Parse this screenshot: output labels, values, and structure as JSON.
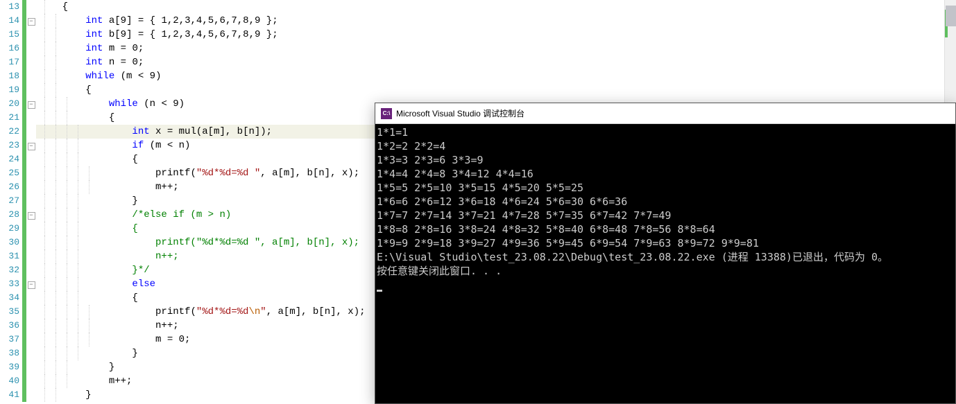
{
  "editor": {
    "startLine": 13,
    "highlightedLine": 22,
    "foldLines": [
      14,
      20,
      23,
      28,
      33
    ],
    "lines": [
      {
        "n": 13,
        "tokens": [
          {
            "t": "{",
            "c": "txt"
          }
        ],
        "indent": 2
      },
      {
        "n": 14,
        "tokens": [
          {
            "t": "int",
            "c": "ty"
          },
          {
            "t": " a[",
            "c": "txt"
          },
          {
            "t": "9",
            "c": "num"
          },
          {
            "t": "] = { ",
            "c": "txt"
          },
          {
            "t": "1",
            "c": "num"
          },
          {
            "t": ",",
            "c": "txt"
          },
          {
            "t": "2",
            "c": "num"
          },
          {
            "t": ",",
            "c": "txt"
          },
          {
            "t": "3",
            "c": "num"
          },
          {
            "t": ",",
            "c": "txt"
          },
          {
            "t": "4",
            "c": "num"
          },
          {
            "t": ",",
            "c": "txt"
          },
          {
            "t": "5",
            "c": "num"
          },
          {
            "t": ",",
            "c": "txt"
          },
          {
            "t": "6",
            "c": "num"
          },
          {
            "t": ",",
            "c": "txt"
          },
          {
            "t": "7",
            "c": "num"
          },
          {
            "t": ",",
            "c": "txt"
          },
          {
            "t": "8",
            "c": "num"
          },
          {
            "t": ",",
            "c": "txt"
          },
          {
            "t": "9",
            "c": "num"
          },
          {
            "t": " };",
            "c": "txt"
          }
        ],
        "indent": 4
      },
      {
        "n": 15,
        "tokens": [
          {
            "t": "int",
            "c": "ty"
          },
          {
            "t": " b[",
            "c": "txt"
          },
          {
            "t": "9",
            "c": "num"
          },
          {
            "t": "] = { ",
            "c": "txt"
          },
          {
            "t": "1",
            "c": "num"
          },
          {
            "t": ",",
            "c": "txt"
          },
          {
            "t": "2",
            "c": "num"
          },
          {
            "t": ",",
            "c": "txt"
          },
          {
            "t": "3",
            "c": "num"
          },
          {
            "t": ",",
            "c": "txt"
          },
          {
            "t": "4",
            "c": "num"
          },
          {
            "t": ",",
            "c": "txt"
          },
          {
            "t": "5",
            "c": "num"
          },
          {
            "t": ",",
            "c": "txt"
          },
          {
            "t": "6",
            "c": "num"
          },
          {
            "t": ",",
            "c": "txt"
          },
          {
            "t": "7",
            "c": "num"
          },
          {
            "t": ",",
            "c": "txt"
          },
          {
            "t": "8",
            "c": "num"
          },
          {
            "t": ",",
            "c": "txt"
          },
          {
            "t": "9",
            "c": "num"
          },
          {
            "t": " };",
            "c": "txt"
          }
        ],
        "indent": 4
      },
      {
        "n": 16,
        "tokens": [
          {
            "t": "int",
            "c": "ty"
          },
          {
            "t": " m = ",
            "c": "txt"
          },
          {
            "t": "0",
            "c": "num"
          },
          {
            "t": ";",
            "c": "txt"
          }
        ],
        "indent": 4
      },
      {
        "n": 17,
        "tokens": [
          {
            "t": "int",
            "c": "ty"
          },
          {
            "t": " n = ",
            "c": "txt"
          },
          {
            "t": "0",
            "c": "num"
          },
          {
            "t": ";",
            "c": "txt"
          }
        ],
        "indent": 4
      },
      {
        "n": 18,
        "tokens": [
          {
            "t": "while",
            "c": "kw"
          },
          {
            "t": " (m < ",
            "c": "txt"
          },
          {
            "t": "9",
            "c": "num"
          },
          {
            "t": ")",
            "c": "txt"
          }
        ],
        "indent": 4
      },
      {
        "n": 19,
        "tokens": [
          {
            "t": "{",
            "c": "txt"
          }
        ],
        "indent": 4
      },
      {
        "n": 20,
        "tokens": [
          {
            "t": "while",
            "c": "kw"
          },
          {
            "t": " (n < ",
            "c": "txt"
          },
          {
            "t": "9",
            "c": "num"
          },
          {
            "t": ")",
            "c": "txt"
          }
        ],
        "indent": 6
      },
      {
        "n": 21,
        "tokens": [
          {
            "t": "{",
            "c": "txt"
          }
        ],
        "indent": 6
      },
      {
        "n": 22,
        "tokens": [
          {
            "t": "int",
            "c": "ty"
          },
          {
            "t": " x = mul(a[m], b[n]);",
            "c": "txt"
          }
        ],
        "indent": 8
      },
      {
        "n": 23,
        "tokens": [
          {
            "t": "if",
            "c": "kw"
          },
          {
            "t": " (m < n)",
            "c": "txt"
          }
        ],
        "indent": 8
      },
      {
        "n": 24,
        "tokens": [
          {
            "t": "{",
            "c": "txt"
          }
        ],
        "indent": 8
      },
      {
        "n": 25,
        "tokens": [
          {
            "t": "printf(",
            "c": "txt"
          },
          {
            "t": "\"%d*%d=%d \"",
            "c": "str"
          },
          {
            "t": ", a[m], b[n], x);",
            "c": "txt"
          }
        ],
        "indent": 10
      },
      {
        "n": 26,
        "tokens": [
          {
            "t": "m++;",
            "c": "txt"
          }
        ],
        "indent": 10
      },
      {
        "n": 27,
        "tokens": [
          {
            "t": "}",
            "c": "txt"
          }
        ],
        "indent": 8
      },
      {
        "n": 28,
        "tokens": [
          {
            "t": "/*else if (m > n)",
            "c": "com"
          }
        ],
        "indent": 8
      },
      {
        "n": 29,
        "tokens": [
          {
            "t": "{",
            "c": "com"
          }
        ],
        "indent": 8
      },
      {
        "n": 30,
        "tokens": [
          {
            "t": "    printf(\"%d*%d=%d \", a[m], b[n], x);",
            "c": "com"
          }
        ],
        "indent": 8
      },
      {
        "n": 31,
        "tokens": [
          {
            "t": "    n++;",
            "c": "com"
          }
        ],
        "indent": 8
      },
      {
        "n": 32,
        "tokens": [
          {
            "t": "}*/",
            "c": "com"
          }
        ],
        "indent": 8
      },
      {
        "n": 33,
        "tokens": [
          {
            "t": "else",
            "c": "kw"
          }
        ],
        "indent": 8
      },
      {
        "n": 34,
        "tokens": [
          {
            "t": "{",
            "c": "txt"
          }
        ],
        "indent": 8
      },
      {
        "n": 35,
        "tokens": [
          {
            "t": "printf(",
            "c": "txt"
          },
          {
            "t": "\"%d*%d=%d",
            "c": "str"
          },
          {
            "t": "\\n",
            "c": "esc"
          },
          {
            "t": "\"",
            "c": "str"
          },
          {
            "t": ", a[m], b[n], x);",
            "c": "txt"
          }
        ],
        "indent": 10
      },
      {
        "n": 36,
        "tokens": [
          {
            "t": "n++;",
            "c": "txt"
          }
        ],
        "indent": 10
      },
      {
        "n": 37,
        "tokens": [
          {
            "t": "m = ",
            "c": "txt"
          },
          {
            "t": "0",
            "c": "num"
          },
          {
            "t": ";",
            "c": "txt"
          }
        ],
        "indent": 10
      },
      {
        "n": 38,
        "tokens": [
          {
            "t": "}",
            "c": "txt"
          }
        ],
        "indent": 8
      },
      {
        "n": 39,
        "tokens": [
          {
            "t": "}",
            "c": "txt"
          }
        ],
        "indent": 6
      },
      {
        "n": 40,
        "tokens": [
          {
            "t": "m++;",
            "c": "txt"
          }
        ],
        "indent": 6
      },
      {
        "n": 41,
        "tokens": [
          {
            "t": "}",
            "c": "txt"
          }
        ],
        "indent": 4
      }
    ]
  },
  "console": {
    "title": "Microsoft Visual Studio 调试控制台",
    "iconText": "C:\\",
    "output": [
      "1*1=1",
      "1*2=2 2*2=4",
      "1*3=3 2*3=6 3*3=9",
      "1*4=4 2*4=8 3*4=12 4*4=16",
      "1*5=5 2*5=10 3*5=15 4*5=20 5*5=25",
      "1*6=6 2*6=12 3*6=18 4*6=24 5*6=30 6*6=36",
      "1*7=7 2*7=14 3*7=21 4*7=28 5*7=35 6*7=42 7*7=49",
      "1*8=8 2*8=16 3*8=24 4*8=32 5*8=40 6*8=48 7*8=56 8*8=64",
      "1*9=9 2*9=18 3*9=27 4*9=36 5*9=45 6*9=54 7*9=63 8*9=72 9*9=81",
      "",
      "E:\\Visual Studio\\test_23.08.22\\Debug\\test_23.08.22.exe (进程 13388)已退出，代码为 0。",
      "按任意键关闭此窗口. . ."
    ]
  }
}
